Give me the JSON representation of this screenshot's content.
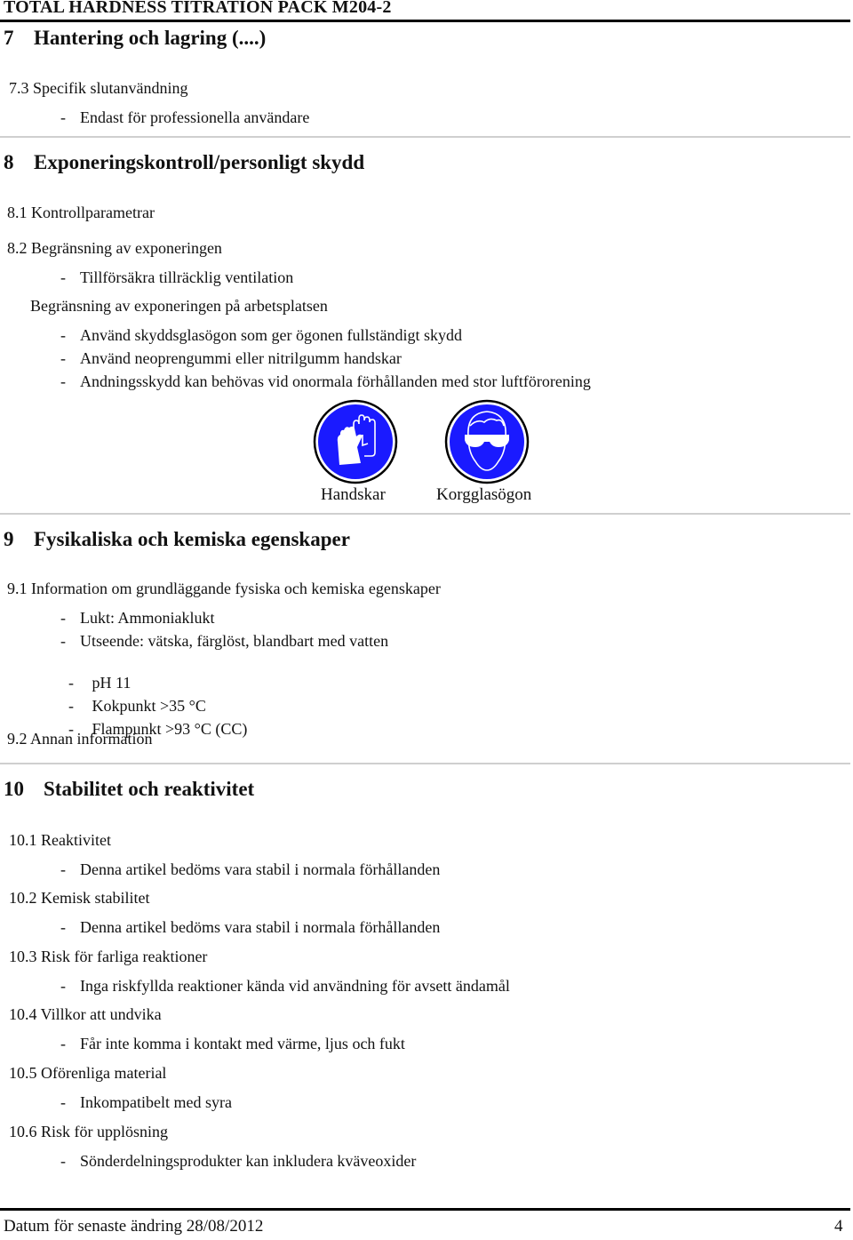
{
  "header": {
    "title": "TOTAL HARDNESS TITRATION PACK M204-2"
  },
  "section7": {
    "number": "7",
    "title": "Hantering och lagring (....)",
    "sub_7_3": {
      "label": "7.3 Specifik slutanvändning",
      "items": [
        "Endast för professionella användare"
      ]
    }
  },
  "section8": {
    "number": "8",
    "title": "Exponeringskontroll/personligt skydd",
    "sub_8_1": {
      "label": "8.1 Kontrollparametrar"
    },
    "sub_8_2": {
      "label": "8.2 Begränsning av exponeringen",
      "items": [
        "Tillförsäkra tillräcklig ventilation"
      ],
      "workplace_label": "Begränsning av exponeringen på arbetsplatsen",
      "workplace_items": [
        "Använd skyddsglasögon som ger ögonen fullständigt skydd",
        "Använd neoprengummi eller nitrilgumm handskar",
        "Andningsskydd kan behövas vid onormala förhållanden med stor luftförorening"
      ]
    },
    "pictograms": [
      {
        "icon": "gloves-icon",
        "caption": "Handskar",
        "color": "#1a1aff"
      },
      {
        "icon": "goggles-icon",
        "caption": "Korgglasögon",
        "color": "#1a1aff"
      }
    ]
  },
  "section9": {
    "number": "9",
    "title": "Fysikaliska och kemiska egenskaper",
    "sub_9_1": {
      "label": "9.1 Information om grundläggande fysiska och kemiska egenskaper",
      "items": [
        "Lukt: Ammoniaklukt",
        "Utseende: vätska, färglöst, blandbart med vatten",
        " pH 11",
        " Kokpunkt >35 °C",
        " Flampunkt >93 °C (CC)"
      ]
    },
    "sub_9_2": {
      "label": "9.2 Annan information"
    }
  },
  "section10": {
    "number": "10",
    "title": "Stabilitet och reaktivitet",
    "subs": [
      {
        "label": "10.1 Reaktivitet",
        "item": "Denna artikel bedöms vara stabil i normala förhållanden"
      },
      {
        "label": "10.2 Kemisk stabilitet",
        "item": "Denna artikel bedöms vara stabil i normala förhållanden"
      },
      {
        "label": "10.3 Risk för farliga reaktioner",
        "item": "Inga riskfyllda reaktioner kända vid användning för avsett ändamål"
      },
      {
        "label": "10.4 Villkor att undvika",
        "item": "Får inte komma i kontakt med värme, ljus och fukt"
      },
      {
        "label": "10.5 Oförenliga material",
        "item": "Inkompatibelt med syra"
      },
      {
        "label": "10.6 Risk för upplösning",
        "item": "Sönderdelningsprodukter kan inkludera kväveoxider"
      }
    ]
  },
  "footer": {
    "revision": "Datum för senaste ändring 28/08/2012",
    "page_number": "4"
  },
  "dash": "-"
}
